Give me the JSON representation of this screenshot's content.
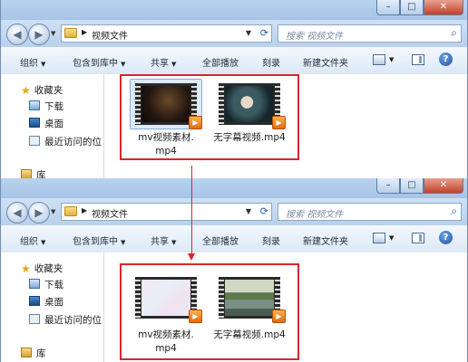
{
  "window1": {
    "address": {
      "path": "视频文件",
      "search_placeholder": "搜索 视频文件"
    },
    "toolbar": [
      "组织",
      "包含到库中",
      "共享",
      "全部播放",
      "刻录",
      "新建文件夹"
    ],
    "nav": {
      "favorites": "收藏夹",
      "downloads": "下载",
      "desktop": "桌面",
      "recent": "最近访问的位",
      "libraries": "库"
    },
    "files": [
      {
        "name_line1": "mv视频素材.",
        "name_line2": "mp4",
        "thumb": "dark-night-scene"
      },
      {
        "name_line1": "无字幕视频.mp4",
        "name_line2": "",
        "thumb": "girl-portrait"
      }
    ]
  },
  "window2": {
    "address": {
      "path": "视频文件",
      "search_placeholder": "搜索 视频文件"
    },
    "toolbar": [
      "组织",
      "包含到库中",
      "共享",
      "全部播放",
      "刻录",
      "新建文件夹"
    ],
    "nav": {
      "favorites": "收藏夹",
      "downloads": "下载",
      "desktop": "桌面",
      "recent": "最近访问的位",
      "libraries": "库"
    },
    "files": [
      {
        "name_line1": "mv视频素材.",
        "name_line2": "mp4",
        "thumb": "blank-pastel"
      },
      {
        "name_line1": "无字幕视频.mp4",
        "name_line2": "",
        "thumb": "lake-landscape"
      }
    ]
  },
  "window_buttons": {
    "minimize": "–",
    "maximize": "□",
    "close": "✕"
  },
  "colors": {
    "highlight": "#d9262c",
    "accent": "#1f5ea8"
  }
}
